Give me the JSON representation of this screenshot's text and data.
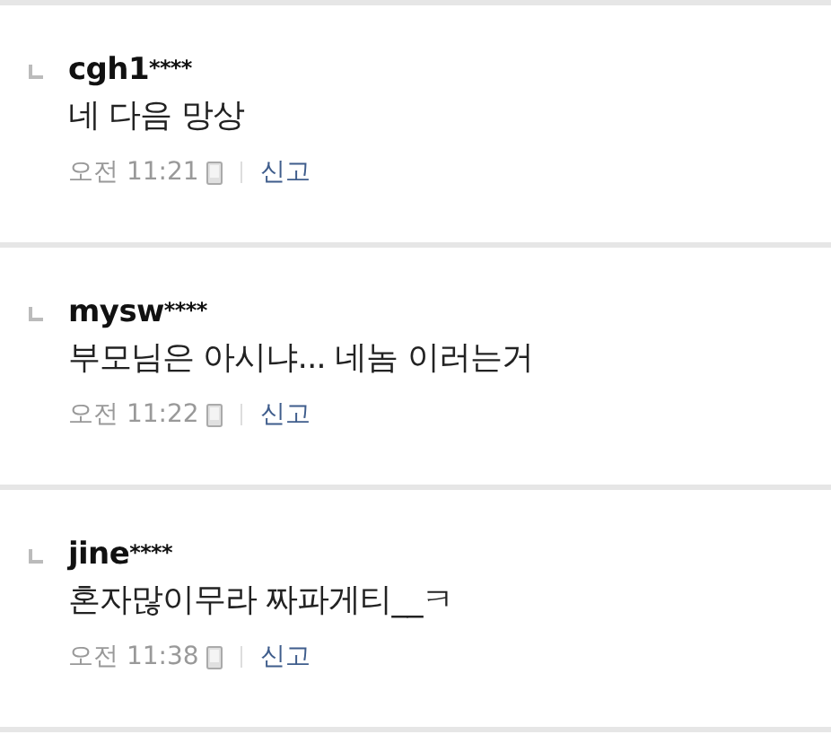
{
  "comments": [
    {
      "author": "cgh1",
      "mask": "****",
      "text": "네 다음 망상",
      "time": "오전 11:21",
      "report": "신고"
    },
    {
      "author": "mysw",
      "mask": "****",
      "text": "부모님은 아시냐... 네놈 이러는거",
      "time": "오전 11:22",
      "report": "신고"
    },
    {
      "author": "jine",
      "mask": "****",
      "text": "혼자많이무라 짜파게티__ㅋ",
      "time": "오전 11:38",
      "report": "신고"
    }
  ]
}
